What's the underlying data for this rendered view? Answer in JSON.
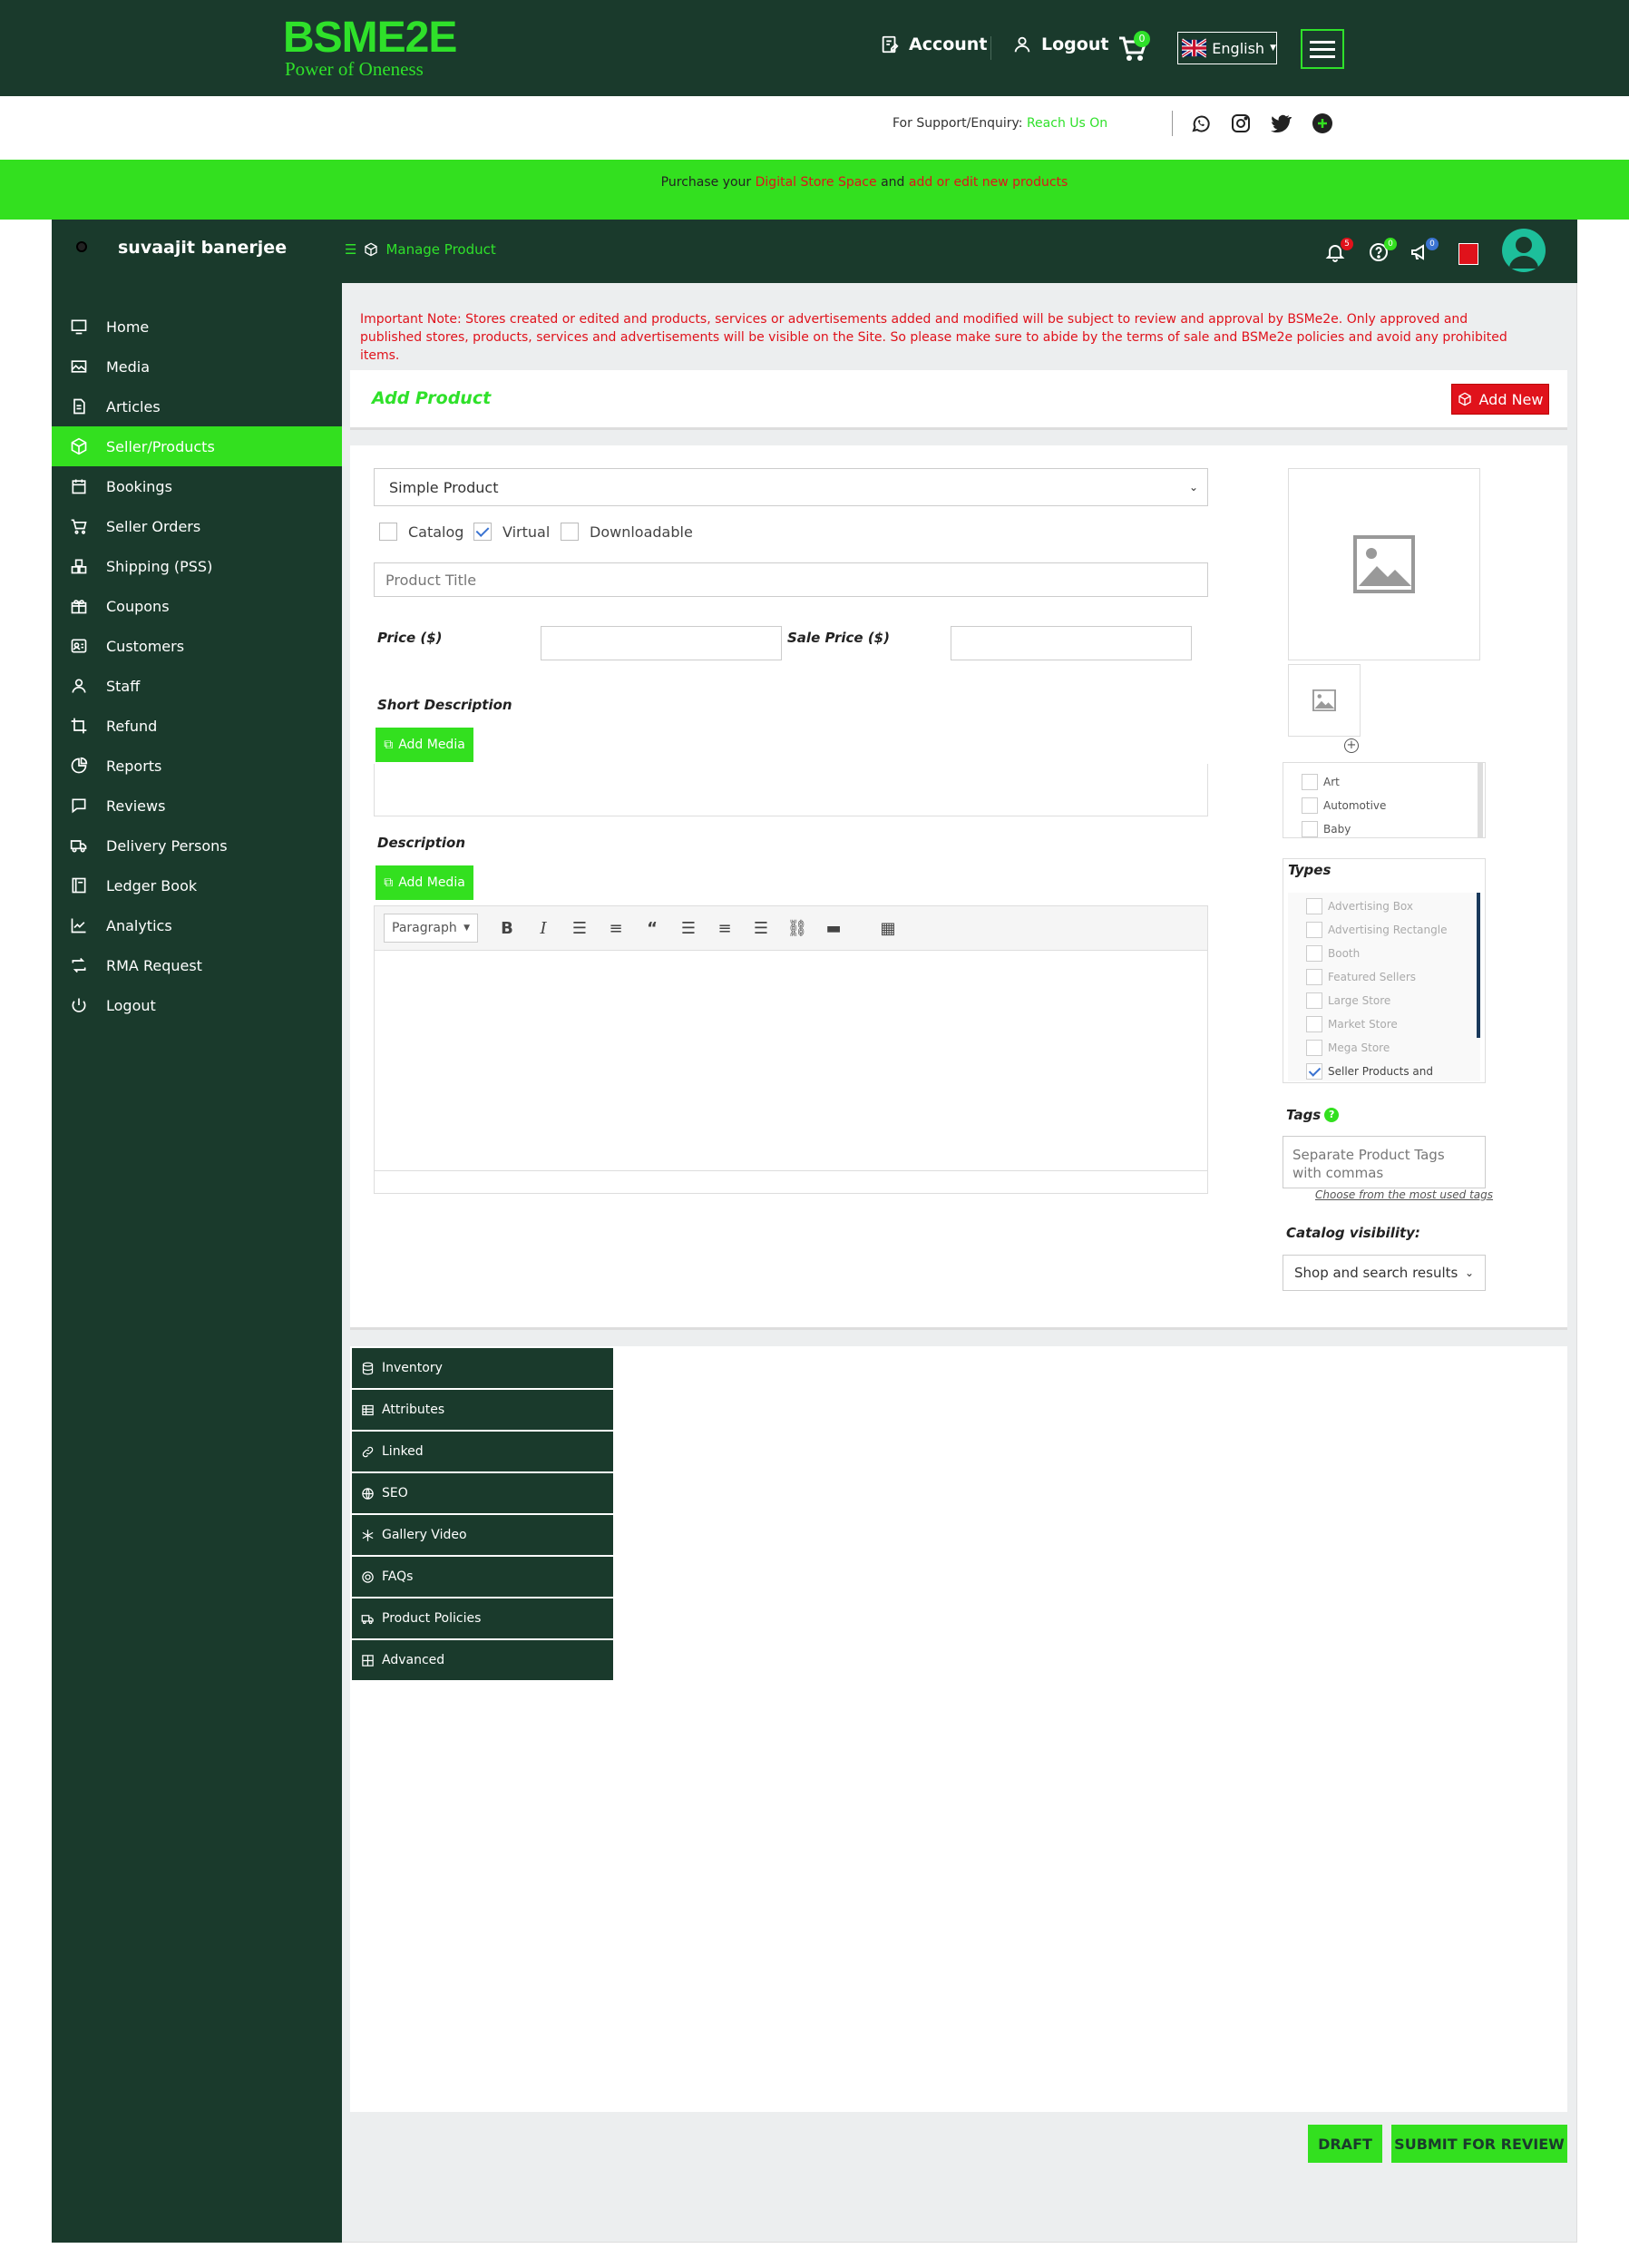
{
  "brand": {
    "logo": "BSME2E",
    "tagline": "Power of Oneness",
    "accent": "#33e01f",
    "dark": "#1a3a2c",
    "alert": "#e0121b"
  },
  "topnav": {
    "account": "Account",
    "logout": "Logout",
    "cart_count": "0",
    "language": "English"
  },
  "support": {
    "text": "For Support/Enquiry:",
    "link": "Reach Us On"
  },
  "promo": {
    "prefix": "Purchase your",
    "link1": "Digital Store Space",
    "mid": "and",
    "link2": "add or edit new products"
  },
  "dashboard": {
    "user_name": "suvaajit banerjee",
    "manage": "Manage Product",
    "badges": {
      "notifications": "5",
      "help": "0",
      "announcements": "0"
    }
  },
  "sidebar": {
    "items": [
      {
        "label": "Home",
        "icon": "monitor-icon"
      },
      {
        "label": "Media",
        "icon": "image-icon"
      },
      {
        "label": "Articles",
        "icon": "document-icon"
      },
      {
        "label": "Seller/Products",
        "icon": "cube-icon"
      },
      {
        "label": "Bookings",
        "icon": "calendar-icon"
      },
      {
        "label": "Seller Orders",
        "icon": "cart-icon"
      },
      {
        "label": "Shipping (PSS)",
        "icon": "boxes-icon"
      },
      {
        "label": "Coupons",
        "icon": "gift-icon"
      },
      {
        "label": "Customers",
        "icon": "customer-icon"
      },
      {
        "label": "Staff",
        "icon": "user-icon"
      },
      {
        "label": "Refund",
        "icon": "crop-icon"
      },
      {
        "label": "Reports",
        "icon": "chart-icon"
      },
      {
        "label": "Reviews",
        "icon": "comment-icon"
      },
      {
        "label": "Delivery Persons",
        "icon": "truck-icon"
      },
      {
        "label": "Ledger Book",
        "icon": "book-icon"
      },
      {
        "label": "Analytics",
        "icon": "line-chart-icon"
      },
      {
        "label": "RMA Request",
        "icon": "retweet-icon"
      },
      {
        "label": "Logout",
        "icon": "power-icon"
      }
    ]
  },
  "notice": "Important Note: Stores created or edited and products, services or advertisements added and modified will be subject to review and approval by BSMe2e. Only approved and published stores, products, services and advertisements will be visible on the Site. So please make sure to abide by the terms of sale and BSMe2e policies and avoid any prohibited items.",
  "add_product": {
    "title": "Add Product",
    "add_new": "Add New"
  },
  "form": {
    "product_type": "Simple Product",
    "checkboxes": {
      "catalog": "Catalog",
      "virtual": "Virtual",
      "downloadable": "Downloadable"
    },
    "title_placeholder": "Product Title",
    "price_label": "Price ($)",
    "sale_price_label": "Sale Price ($)",
    "short_desc_label": "Short Description",
    "desc_label": "Description",
    "add_media": "Add Media",
    "paragraph": "Paragraph"
  },
  "categories": [
    "Art",
    "Automotive",
    "Baby"
  ],
  "types": {
    "label": "Types",
    "items": [
      "Advertising Box",
      "Advertising Rectangle",
      "Booth",
      "Featured Sellers",
      "Large Store",
      "Market Store",
      "Mega Store",
      "Seller Products and"
    ]
  },
  "tags": {
    "label": "Tags",
    "help": "?",
    "placeholder": "Separate Product Tags with commas",
    "link": "Choose from the most used tags"
  },
  "visibility": {
    "label": "Catalog visibility:",
    "value": "Shop and search results"
  },
  "tabs": [
    "Inventory",
    "Attributes",
    "Linked",
    "SEO",
    "Gallery Video",
    "FAQs",
    "Product Policies",
    "Advanced"
  ],
  "actions": {
    "draft": "DRAFT",
    "submit": "SUBMIT FOR REVIEW"
  }
}
